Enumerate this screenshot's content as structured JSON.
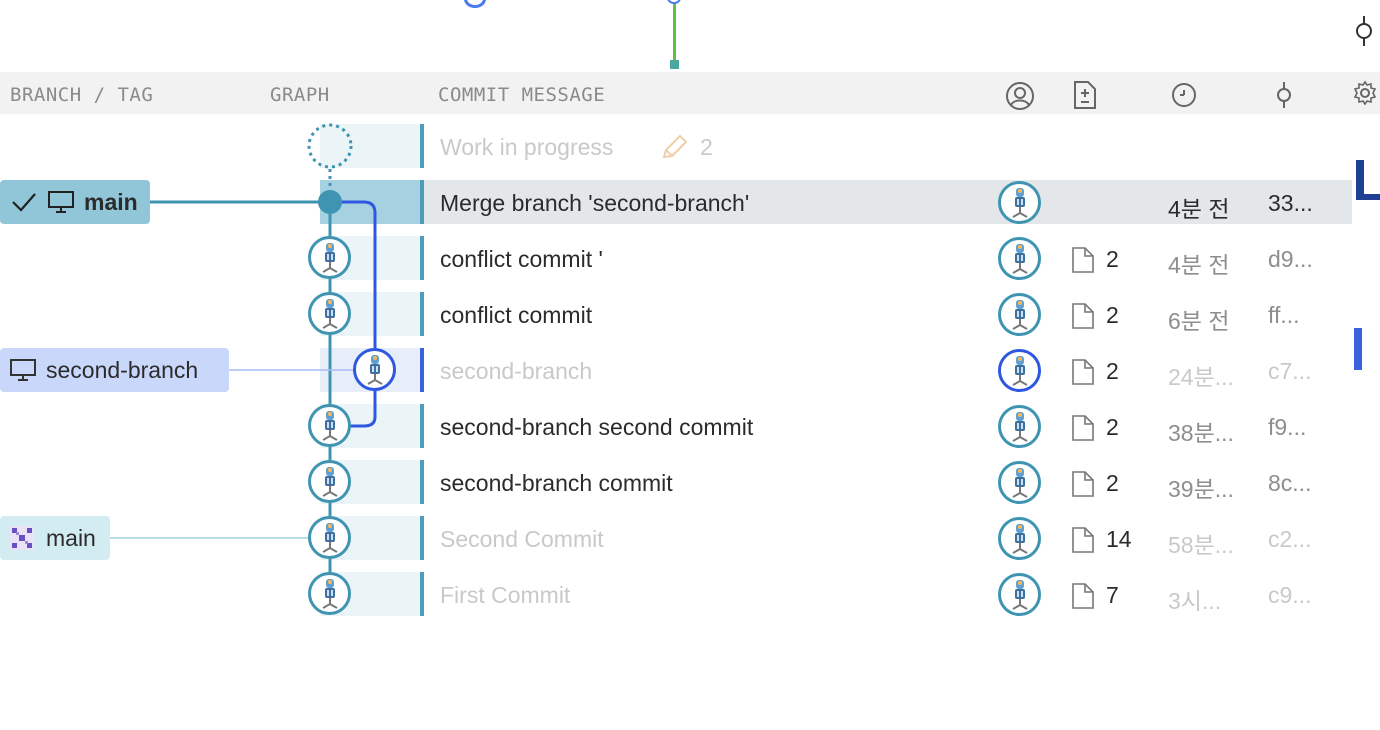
{
  "columns": {
    "branch_tag": "BRANCH / TAG",
    "graph": "GRAPH",
    "commit_message": "COMMIT MESSAGE"
  },
  "header_icons": [
    "author-icon",
    "changes-icon",
    "date-icon",
    "sha-icon",
    "settings-icon"
  ],
  "wip": {
    "label": "Work in progress",
    "count": "2"
  },
  "branches": {
    "main_local": "main",
    "second_local": "second-branch",
    "main_remote": "main"
  },
  "commits": [
    {
      "message": "Merge branch 'second-branch'",
      "changes": "",
      "time": "4분 전",
      "sha": "33..."
    },
    {
      "message": "conflict commit  '",
      "changes": "2",
      "time": "4분 전",
      "sha": "d9..."
    },
    {
      "message": "conflict commit",
      "changes": "2",
      "time": "6분 전",
      "sha": "ff..."
    },
    {
      "message": "second-branch",
      "changes": "2",
      "time": "24분...",
      "sha": "c7..."
    },
    {
      "message": "second-branch second commit",
      "changes": "2",
      "time": "38분...",
      "sha": "f9..."
    },
    {
      "message": "second-branch commit",
      "changes": "2",
      "time": "39분...",
      "sha": "8c..."
    },
    {
      "message": "Second Commit",
      "changes": "14",
      "time": "58분...",
      "sha": "c2..."
    },
    {
      "message": "First Commit",
      "changes": "7",
      "time": "3시...",
      "sha": "c9..."
    }
  ],
  "colors": {
    "main_lane": "#3f95b1",
    "second_lane": "#2f58e0",
    "selected_row": "#e4e7ea",
    "main_tag": "#90c6d8"
  }
}
